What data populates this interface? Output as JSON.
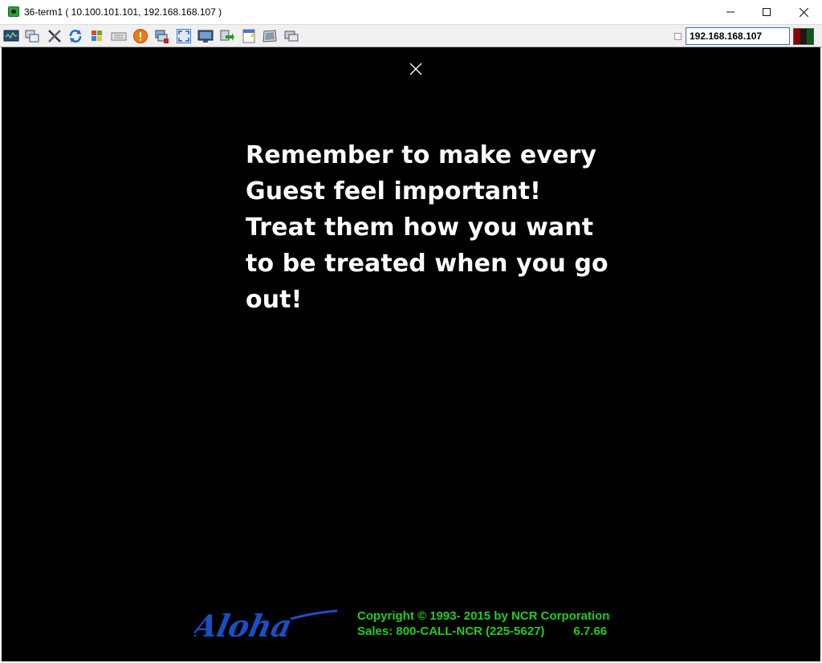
{
  "window": {
    "title": "36-term1 ( 10.100.101.101, 192.168.168.107 )",
    "minimize_icon": "minimize-icon",
    "maximize_icon": "maximize-icon",
    "close_icon": "close-icon"
  },
  "toolbar": {
    "icons": [
      "monitor-icon",
      "windows-icon",
      "tools-icon",
      "refresh-icon",
      "windows-flag-icon",
      "keyboard-icon",
      "alert-icon",
      "disconnect-icon",
      "fullscreen-icon",
      "display-icon",
      "transfer-icon",
      "notepad-icon",
      "screen-icon",
      "chat-icon"
    ],
    "ip_address": "192.168.168.107"
  },
  "screen": {
    "message_lines": [
      "Remember to make every",
      "Guest feel important!",
      "Treat them how you want",
      "to be treated when you go",
      "out!"
    ],
    "logo_text": "Aloha",
    "copyright": "Copyright © 1993- 2015 by NCR Corporation",
    "sales": "Sales: 800-CALL-NCR (225-5627)",
    "version": "6.7.66",
    "colors": {
      "background": "#000000",
      "message": "#ffffff",
      "footer_text": "#22cc22",
      "logo": "#1a4fc4"
    }
  }
}
